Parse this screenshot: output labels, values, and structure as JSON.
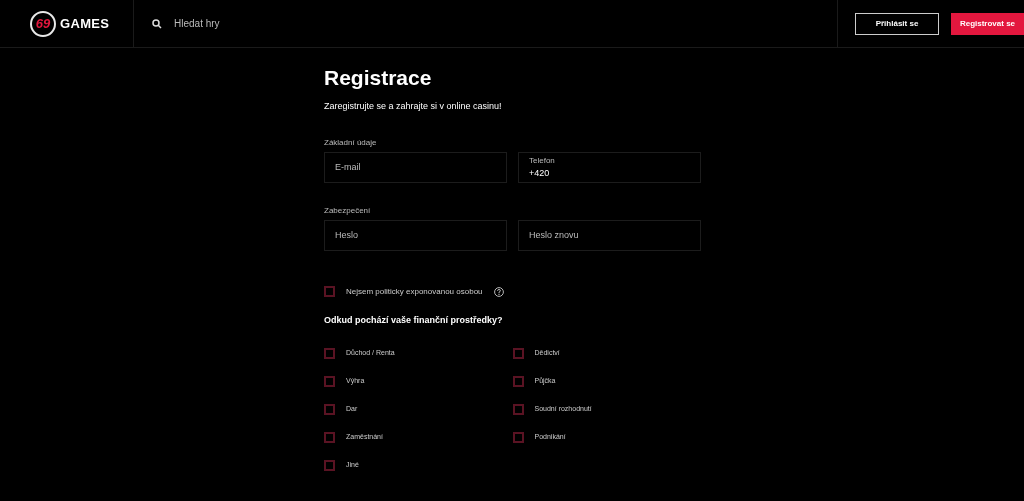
{
  "header": {
    "logo": {
      "mark": "69",
      "name": "GAMES"
    },
    "search": {
      "placeholder": "Hledat hry"
    },
    "buttons": [
      {
        "label": "Přihlásit se",
        "kind": "outline"
      },
      {
        "label": "Registrovat se",
        "kind": "primary"
      }
    ]
  },
  "form": {
    "title": "Registrace",
    "subtitle": "Zaregistrujte se a zahrajte si v online casinu!",
    "sections": [
      {
        "label": "Základní údaje",
        "fields": [
          {
            "placeholder": "E-mail"
          },
          {
            "label": "Telefon",
            "value": "+420"
          }
        ]
      },
      {
        "label": "Zabezpečení",
        "fields": [
          {
            "placeholder": "Heslo"
          },
          {
            "placeholder": "Heslo znovu"
          }
        ]
      }
    ],
    "pep": {
      "label": "Nejsem politicky exponovanou osobou",
      "checked": false
    },
    "question": "Odkud pochází vaše finanční prostředky?",
    "options": [
      {
        "label": "Důchod / Renta",
        "checked": false
      },
      {
        "label": "Dědictví",
        "checked": false
      },
      {
        "label": "Výhra",
        "checked": false
      },
      {
        "label": "Půjčka",
        "checked": false
      },
      {
        "label": "Dar",
        "checked": false
      },
      {
        "label": "Soudní rozhodnutí",
        "checked": false
      },
      {
        "label": "Zaměstnání",
        "checked": false
      },
      {
        "label": "Podnikání",
        "checked": false
      },
      {
        "label": "Jiné",
        "checked": false
      }
    ]
  }
}
